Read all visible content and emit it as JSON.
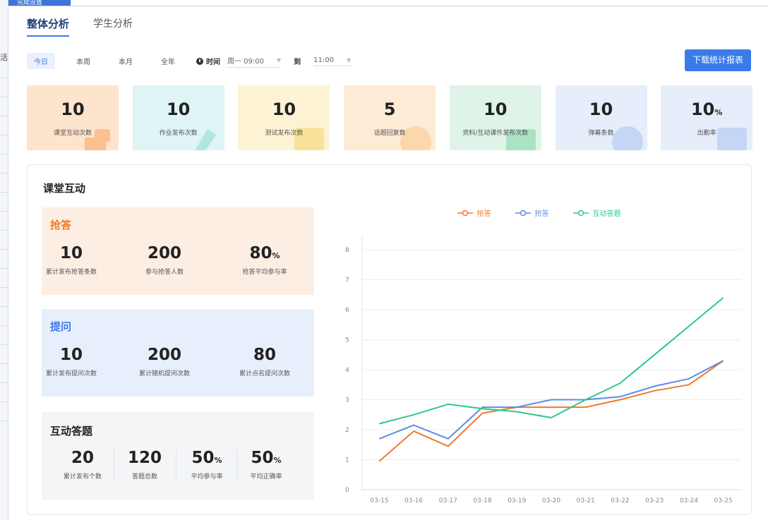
{
  "background": {
    "side_text": "活",
    "top_tag": "完成设置"
  },
  "tabs": [
    {
      "label": "整体分析",
      "active": true
    },
    {
      "label": "学生分析",
      "active": false
    }
  ],
  "filters": {
    "ranges": [
      {
        "label": "今日",
        "active": true
      },
      {
        "label": "本周",
        "active": false
      },
      {
        "label": "本月",
        "active": false
      },
      {
        "label": "全年",
        "active": false
      }
    ],
    "time_label": "时间",
    "start": "周一 09:00",
    "to_label": "到",
    "end": "11:00"
  },
  "download_label": "下载统计报表",
  "cards": [
    {
      "value": "10",
      "unit": "",
      "label": "课堂互动次数",
      "bg": "#fde4cc",
      "accent": "#f7a35c"
    },
    {
      "value": "10",
      "unit": "",
      "label": "作业发布次数",
      "bg": "#dff4f4",
      "accent": "#8fd9d3"
    },
    {
      "value": "10",
      "unit": "",
      "label": "测试发布次数",
      "bg": "#fdf3d4",
      "accent": "#f5d46a"
    },
    {
      "value": "5",
      "unit": "",
      "label": "话题回复数",
      "bg": "#fdebd6",
      "accent": "#f7c88a"
    },
    {
      "value": "10",
      "unit": "",
      "label": "资料/互动课件发布次数",
      "bg": "#dff3e8",
      "accent": "#7fd3a7"
    },
    {
      "value": "10",
      "unit": "",
      "label": "弹幕条数",
      "bg": "#e6edfb",
      "accent": "#a9c1f0"
    },
    {
      "value": "10",
      "unit": "%",
      "label": "出勤率",
      "bg": "#e6edfb",
      "accent": "#a9c1f0"
    }
  ],
  "interaction": {
    "title": "课堂互动",
    "qiangda": {
      "title": "抢答",
      "title_color": "#ef7a2d",
      "bg": "#fdeee4",
      "stats": [
        {
          "value": "10",
          "unit": "",
          "label": "累计发布抢答条数"
        },
        {
          "value": "200",
          "unit": "",
          "label": "参与抢答人数"
        },
        {
          "value": "80",
          "unit": "%",
          "label": "抢答平均参与率"
        }
      ]
    },
    "tiwen": {
      "title": "提问",
      "title_color": "#3a7bea",
      "bg": "#e8effc",
      "stats": [
        {
          "value": "10",
          "unit": "",
          "label": "累计发布提问次数"
        },
        {
          "value": "200",
          "unit": "",
          "label": "累计随机提问次数"
        },
        {
          "value": "80",
          "unit": "",
          "label": "累计点名提问次数"
        }
      ]
    },
    "dati": {
      "title": "互动答题",
      "title_color": "#222222",
      "bg": "#f4f5f7",
      "stats": [
        {
          "value": "20",
          "unit": "",
          "label": "累计发布个数"
        },
        {
          "value": "120",
          "unit": "",
          "label": "答题总数"
        },
        {
          "value": "50",
          "unit": "%",
          "label": "平均参与率"
        },
        {
          "value": "50",
          "unit": "%",
          "label": "平均正确率"
        }
      ]
    }
  },
  "chart_data": {
    "type": "line",
    "categories": [
      "03-15",
      "03-16",
      "03-17",
      "03-18",
      "03-19",
      "03-20",
      "03-21",
      "03-22",
      "03-23",
      "03-24",
      "03-25"
    ],
    "ylim": [
      0,
      8
    ],
    "yticks": [
      "0",
      "1",
      "2",
      "3",
      "4",
      "5",
      "6",
      "7",
      "8"
    ],
    "grid": true,
    "legend_position": "top-center",
    "series": [
      {
        "name": "抢答",
        "color": "#ef7a2d",
        "values": [
          0.95,
          1.95,
          1.45,
          2.55,
          2.75,
          2.75,
          2.75,
          3.0,
          3.3,
          3.5,
          4.3
        ]
      },
      {
        "name": "抢答",
        "color": "#5b8de6",
        "values": [
          1.7,
          2.15,
          1.7,
          2.75,
          2.75,
          3.0,
          3.0,
          3.1,
          3.45,
          3.7,
          4.3
        ]
      },
      {
        "name": "互动答题",
        "color": "#2fc78c",
        "values": [
          2.2,
          2.5,
          2.85,
          2.7,
          2.6,
          2.4,
          3.0,
          3.55,
          4.5,
          5.45,
          6.4
        ]
      }
    ]
  }
}
